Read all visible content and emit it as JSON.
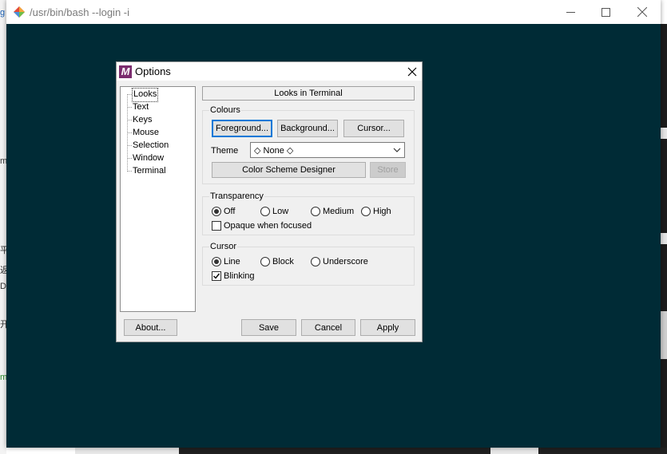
{
  "window": {
    "title": "/usr/bin/bash --login -i",
    "background_color": "#002b36"
  },
  "background_fragments": [
    "g",
    "m",
    "平",
    "返",
    "Dl",
    "开",
    "m"
  ],
  "dialog": {
    "title": "Options",
    "logo": "M",
    "tree": [
      "Looks",
      "Text",
      "Keys",
      "Mouse",
      "Selection",
      "Window",
      "Terminal"
    ],
    "selected_tree_item": "Looks",
    "page_title": "Looks in Terminal",
    "colours": {
      "label": "Colours",
      "foreground": "Foreground...",
      "background": "Background...",
      "cursor": "Cursor...",
      "theme_label": "Theme",
      "theme_value": "◇ None ◇",
      "designer": "Color Scheme Designer",
      "store": "Store"
    },
    "transparency": {
      "label": "Transparency",
      "options": [
        "Off",
        "Low",
        "Medium",
        "High"
      ],
      "selected": "Off",
      "opaque_label": "Opaque when focused",
      "opaque_checked": false
    },
    "cursor": {
      "label": "Cursor",
      "options": [
        "Line",
        "Block",
        "Underscore"
      ],
      "selected": "Line",
      "blinking_label": "Blinking",
      "blinking_checked": true
    },
    "buttons": {
      "about": "About...",
      "save": "Save",
      "cancel": "Cancel",
      "apply": "Apply"
    }
  }
}
